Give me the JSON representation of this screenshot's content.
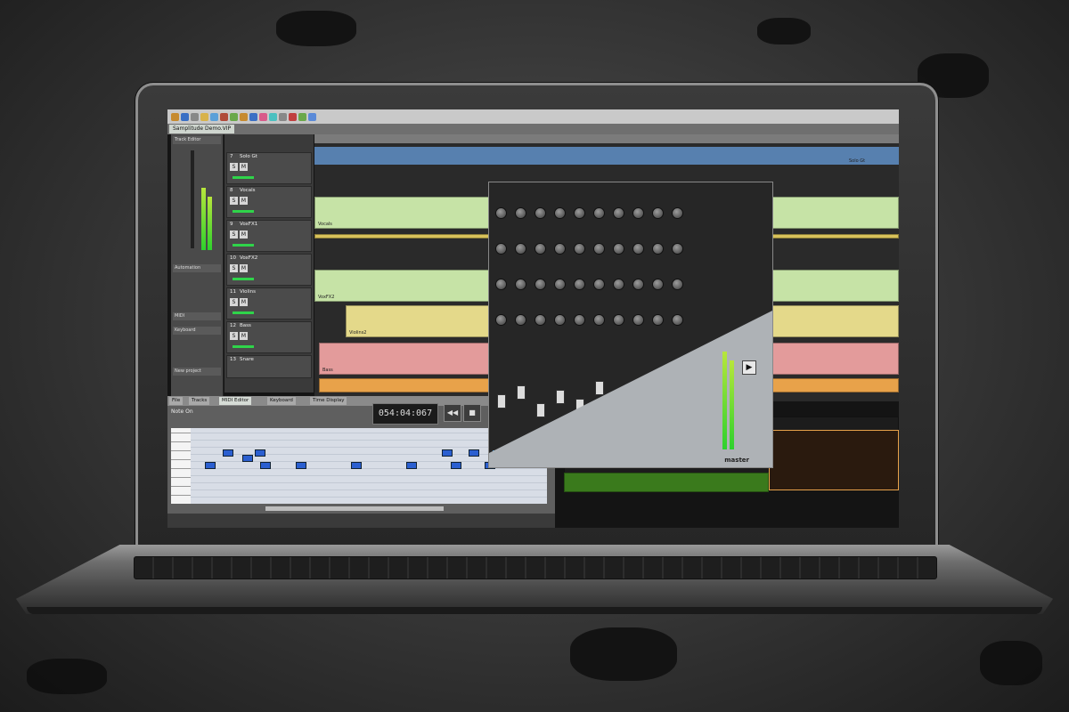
{
  "app": {
    "project_tab": "Samplitude Demo.VIP",
    "left_panel": [
      "Track Editor",
      "Automation",
      "MIDI",
      "Keyboard",
      "New project"
    ]
  },
  "tracks": [
    {
      "number": "7",
      "name": "Solo Gt"
    },
    {
      "number": "8",
      "name": "Vocals"
    },
    {
      "number": "9",
      "name": "VoxFX1"
    },
    {
      "number": "10",
      "name": "VoxFX2"
    },
    {
      "number": "11",
      "name": "Violins"
    },
    {
      "number": "12",
      "name": "Bass"
    },
    {
      "number": "13",
      "name": "Snare"
    }
  ],
  "clips": {
    "solo": "Solo Gt",
    "vocals": "Vocals",
    "voxfx2": "VoxFX2",
    "violins": "Violins2",
    "bass": "Bass"
  },
  "midi_editor": {
    "tabs": [
      "File",
      "Tracks",
      "MIDI Editor",
      "Keyboard",
      "Time Display"
    ],
    "event_label": "Note On",
    "time": "054:04:067"
  },
  "transport": {
    "rewind": "◀◀",
    "stop": "■",
    "play": "▶"
  },
  "mixer": {
    "master_label": "master"
  },
  "colors": {
    "green_clip": "#c6e3a6",
    "yellow_clip": "#e4d98a",
    "red_clip": "#e39b9b",
    "blue_clip": "#5f8fc7",
    "orange_clip": "#e8a24a"
  },
  "icons": [
    "toolbar-icon",
    "play-icon",
    "rewind-icon",
    "stop-icon"
  ]
}
